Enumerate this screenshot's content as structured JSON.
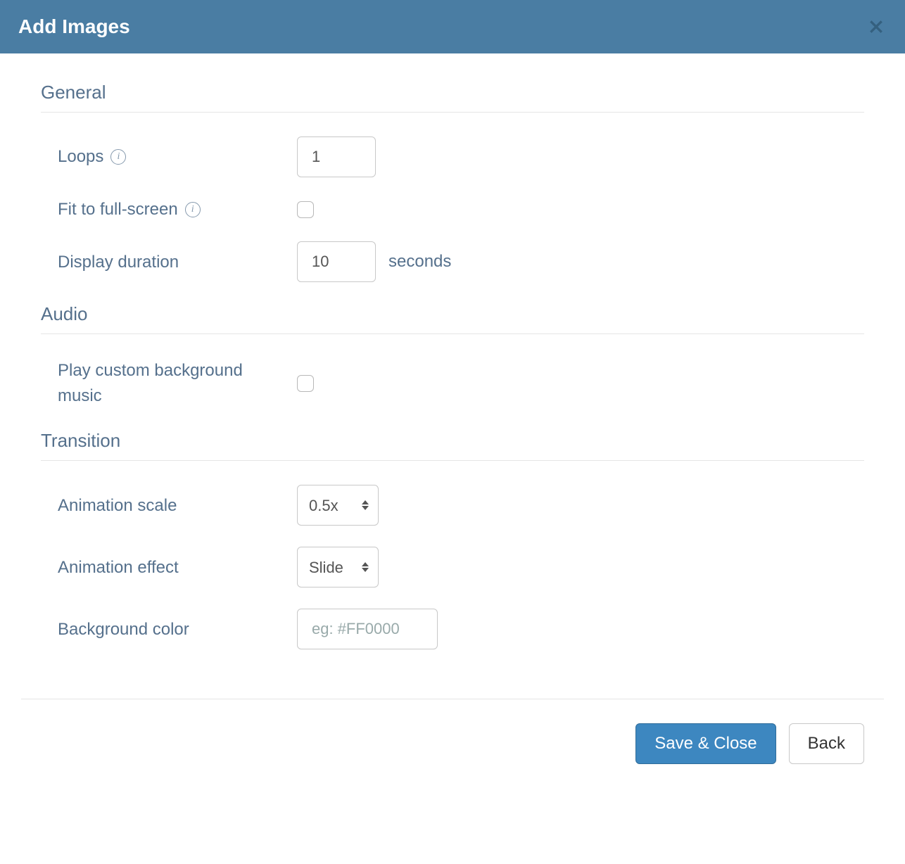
{
  "header": {
    "title": "Add Images"
  },
  "sections": {
    "general": {
      "title": "General",
      "loops_label": "Loops",
      "loops_value": "1",
      "fit_fullscreen_label": "Fit to full-screen",
      "fit_fullscreen_checked": false,
      "display_duration_label": "Display duration",
      "display_duration_value": "10",
      "display_duration_unit": "seconds"
    },
    "audio": {
      "title": "Audio",
      "play_custom_music_label": "Play custom background music",
      "play_custom_music_checked": false
    },
    "transition": {
      "title": "Transition",
      "animation_scale_label": "Animation scale",
      "animation_scale_value": "0.5x",
      "animation_effect_label": "Animation effect",
      "animation_effect_value": "Slide",
      "background_color_label": "Background color",
      "background_color_value": "",
      "background_color_placeholder": "eg: #FF0000"
    }
  },
  "footer": {
    "save_close_label": "Save & Close",
    "back_label": "Back"
  }
}
